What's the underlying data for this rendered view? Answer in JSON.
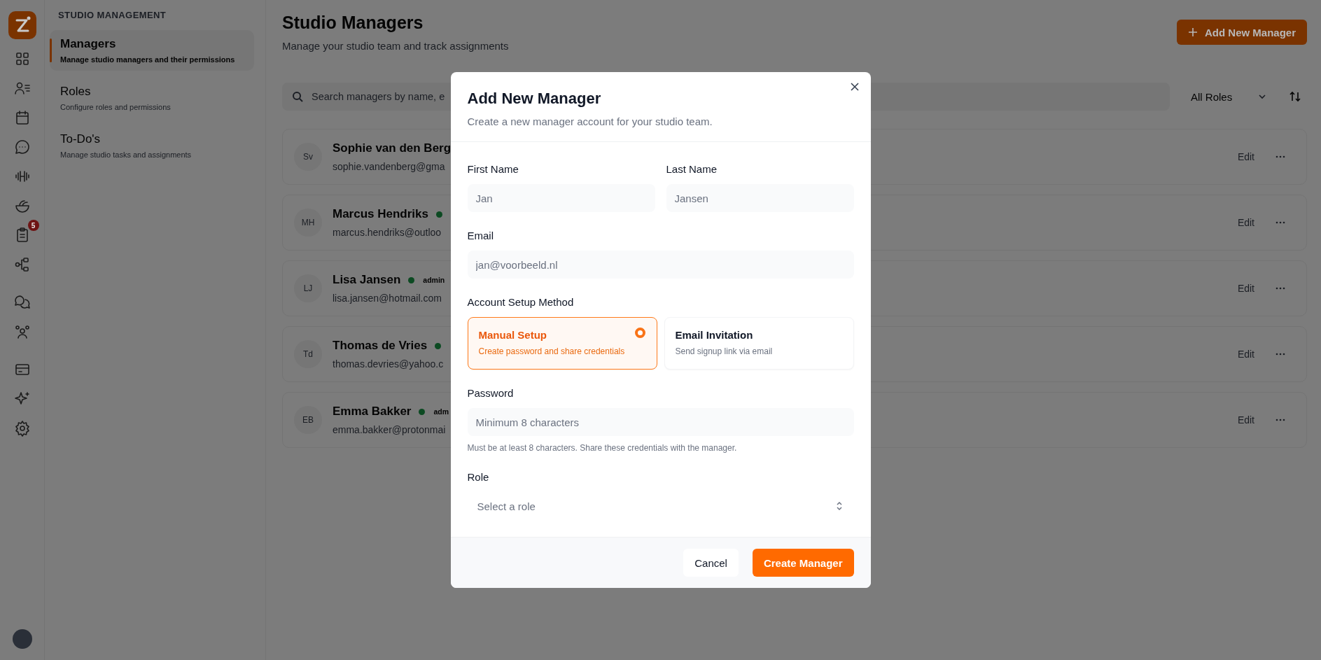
{
  "rail": {
    "groups": [
      {
        "items": [
          {
            "kind": "grid"
          },
          {
            "kind": "user-list"
          },
          {
            "kind": "calendar"
          },
          {
            "kind": "chat"
          },
          {
            "kind": "dumbbell"
          },
          {
            "kind": "bowl"
          },
          {
            "kind": "clipboard",
            "badge": "5"
          },
          {
            "kind": "flow"
          }
        ]
      },
      {
        "items": [
          {
            "kind": "chats"
          },
          {
            "kind": "group"
          }
        ]
      },
      {
        "items": [
          {
            "kind": "card"
          },
          {
            "kind": "sparkle"
          },
          {
            "kind": "settings"
          }
        ]
      }
    ]
  },
  "sidebar": {
    "heading": "STUDIO MANAGEMENT",
    "items": [
      {
        "label": "Managers",
        "description": "Manage studio managers and their permissions",
        "selected": true
      },
      {
        "label": "Roles",
        "description": "Configure roles and permissions",
        "selected": false
      },
      {
        "label": "To-Do's",
        "description": "Manage studio tasks and assignments",
        "selected": false
      }
    ]
  },
  "header": {
    "title": "Studio Managers",
    "subtitle": "Manage your studio team and track assignments",
    "add_button": "Add New Manager"
  },
  "toolbar": {
    "search_placeholder": "Search managers by name, e",
    "role_filter": "All Roles"
  },
  "managers": [
    {
      "initials": "Sv",
      "name": "Sophie van den Berg",
      "online": false,
      "email": "sophie.vandenberg@gma",
      "edit": "Edit"
    },
    {
      "initials": "MH",
      "name": "Marcus Hendriks",
      "online": true,
      "email": "marcus.hendriks@outloo",
      "edit": "Edit"
    },
    {
      "initials": "LJ",
      "name": "Lisa Jansen",
      "online": true,
      "role": "admin",
      "email": "lisa.jansen@hotmail.com",
      "edit": "Edit"
    },
    {
      "initials": "Td",
      "name": "Thomas de Vries",
      "online": true,
      "email": "thomas.devries@yahoo.c",
      "edit": "Edit"
    },
    {
      "initials": "EB",
      "name": "Emma Bakker",
      "online": true,
      "role": "adm",
      "email": "emma.bakker@protonmai",
      "edit": "Edit"
    }
  ],
  "modal": {
    "title": "Add New Manager",
    "subtitle": "Create a new manager account for your studio team.",
    "first_name": {
      "label": "First Name",
      "placeholder": "Jan"
    },
    "last_name": {
      "label": "Last Name",
      "placeholder": "Jansen"
    },
    "email": {
      "label": "Email",
      "placeholder": "jan@voorbeeld.nl"
    },
    "setup": {
      "label": "Account Setup Method",
      "options": [
        {
          "title": "Manual Setup",
          "description": "Create password and share credentials",
          "selected": true
        },
        {
          "title": "Email Invitation",
          "description": "Send signup link via email",
          "selected": false
        }
      ]
    },
    "password": {
      "label": "Password",
      "placeholder": "Minimum 8 characters",
      "hint": "Must be at least 8 characters. Share these credentials with the manager."
    },
    "role": {
      "label": "Role",
      "placeholder": "Select a role"
    },
    "cancel": "Cancel",
    "submit": "Create Manager"
  }
}
